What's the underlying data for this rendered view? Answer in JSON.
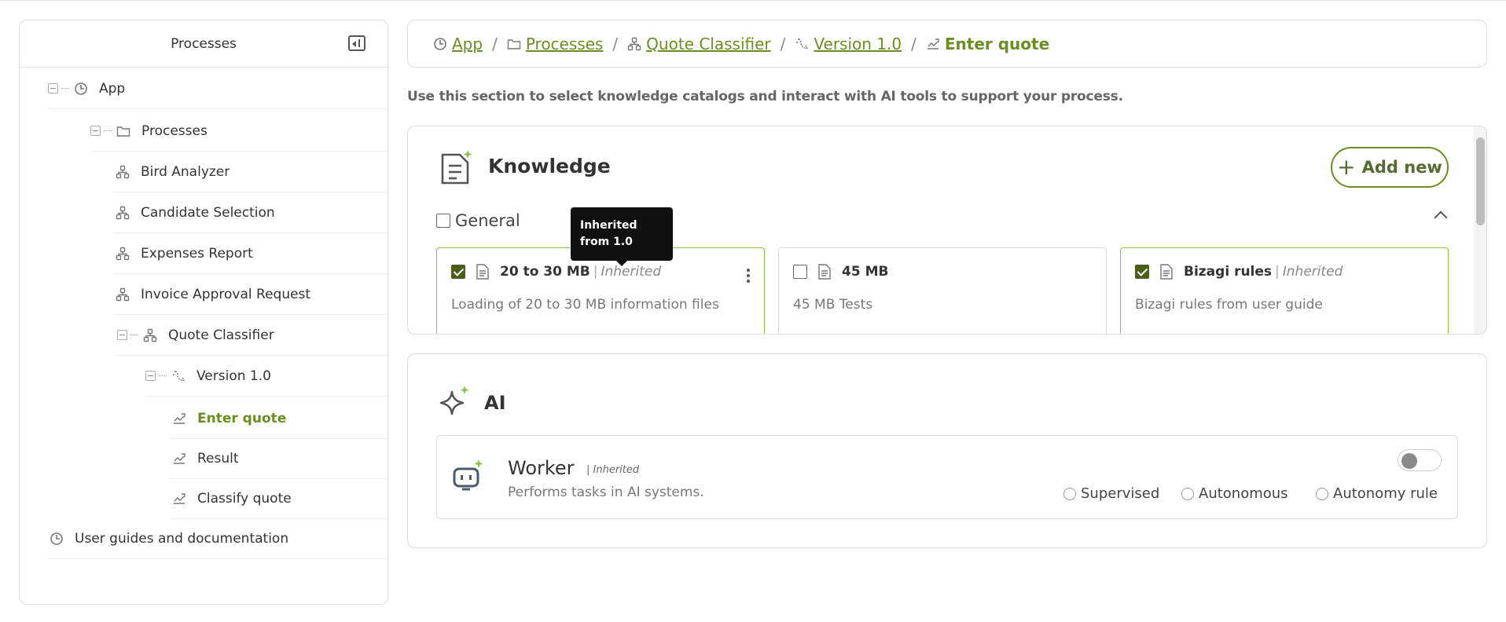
{
  "sidebar": {
    "title": "Processes",
    "items": [
      {
        "label": "App",
        "icon": "app-icon"
      },
      {
        "label": "Processes",
        "icon": "folder-icon"
      },
      {
        "label": "Bird Analyzer",
        "icon": "process-icon"
      },
      {
        "label": "Candidate Selection",
        "icon": "process-icon"
      },
      {
        "label": "Expenses Report",
        "icon": "process-icon"
      },
      {
        "label": "Invoice Approval Request",
        "icon": "process-icon"
      },
      {
        "label": "Quote Classifier",
        "icon": "process-icon"
      },
      {
        "label": "Version 1.0",
        "icon": "version-icon"
      },
      {
        "label": "Enter quote",
        "icon": "task-icon",
        "active": true
      },
      {
        "label": "Result",
        "icon": "task-icon"
      },
      {
        "label": "Classify quote",
        "icon": "task-icon"
      },
      {
        "label": "User guides and documentation",
        "icon": "app-icon"
      }
    ]
  },
  "breadcrumb": [
    {
      "label": "App",
      "icon": "app-icon"
    },
    {
      "label": "Processes",
      "icon": "folder-icon"
    },
    {
      "label": "Quote Classifier",
      "icon": "process-icon"
    },
    {
      "label": "Version 1.0",
      "icon": "version-icon"
    },
    {
      "label": "Enter quote",
      "icon": "task-icon",
      "current": true
    }
  ],
  "intro": "Use this section to select knowledge catalogs and interact with AI tools to support your process.",
  "knowledge": {
    "title": "Knowledge",
    "add_label": "Add new",
    "group_label": "General",
    "tooltip": "Inherited from 1.0",
    "cards": [
      {
        "name": "20 to 30 MB",
        "checked": true,
        "inherited": "Inherited",
        "desc": "Loading of 20 to 30 MB information files"
      },
      {
        "name": "45 MB",
        "checked": false,
        "inherited": "",
        "desc": "45 MB Tests"
      },
      {
        "name": "Bizagi rules",
        "checked": true,
        "inherited": "Inherited",
        "desc": "Bizagi rules from user guide"
      }
    ]
  },
  "ai": {
    "title": "AI",
    "worker": {
      "name": "Worker",
      "inherited": "| Inherited",
      "desc": "Performs tasks in AI systems.",
      "enabled": false,
      "options": [
        "Supervised",
        "Autonomous",
        "Autonomy rule"
      ]
    }
  },
  "colors": {
    "accent": "#6b8e23",
    "check": "#4b5f1b",
    "card_selected": "#8bc34a"
  }
}
